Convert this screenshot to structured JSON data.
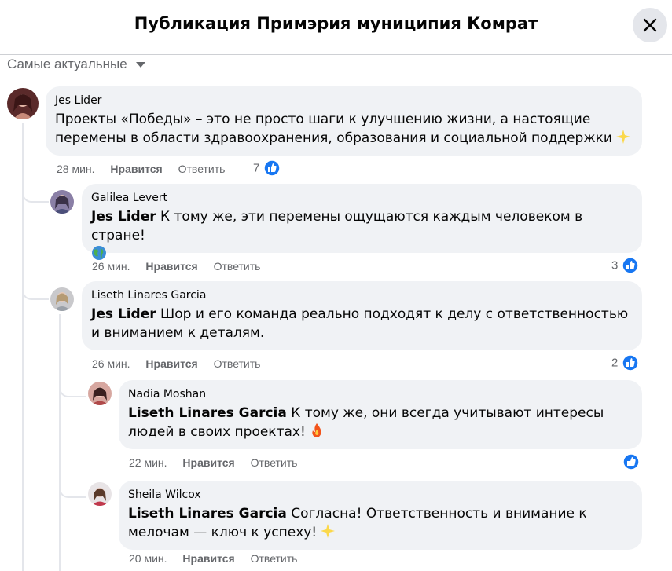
{
  "header": {
    "title": "Публикация Примэрия муниципия Комрат"
  },
  "sort": {
    "label": "Самые актуальные"
  },
  "comments": [
    {
      "author": "Jes Lider",
      "text": "Проекты «Победы» – это не просто шаги к улучшению жизни, а настоящие перемены в области здравоохранения, образования и социальной поддержки",
      "emoji": "sparkle-emoji",
      "time": "28 мин.",
      "like_label": "Нравится",
      "reply_label": "Ответить",
      "reactions": "7"
    },
    {
      "author": "Galilea Levert",
      "mention": "Jes Lider",
      "text": "К тому же, эти перемены ощущаются каждым человеком в стране!",
      "emoji": "globe-emoji",
      "time": "26 мин.",
      "like_label": "Нравится",
      "reply_label": "Ответить",
      "reactions": "3"
    },
    {
      "author": "Liseth Linares Garcia",
      "mention": "Jes Lider",
      "text": "Шор и его команда реально подходят к делу с ответственностью и вниманием к деталям.",
      "time": "26 мин.",
      "like_label": "Нравится",
      "reply_label": "Ответить",
      "reactions": "2"
    },
    {
      "author": "Nadia Moshan",
      "mention": "Liseth Linares Garcia",
      "text": "К тому же, они всегда учитывают интересы людей в своих проектах!",
      "emoji": "fire-emoji",
      "time": "22 мин.",
      "like_label": "Нравится",
      "reply_label": "Ответить",
      "reactions": ""
    },
    {
      "author": "Sheila Wilcox",
      "mention": "Liseth Linares Garcia",
      "text": "Согласна! Ответственность и внимание к мелочам — ключ к успеху!",
      "emoji": "sparkle-emoji",
      "time": "20 мин.",
      "like_label": "Нравится",
      "reply_label": "Ответить"
    }
  ],
  "colors": {
    "bubble": "#f0f2f5",
    "meta_text": "#65676b",
    "like_blue": "#1877f2",
    "thread_line": "#e4e6eb"
  }
}
